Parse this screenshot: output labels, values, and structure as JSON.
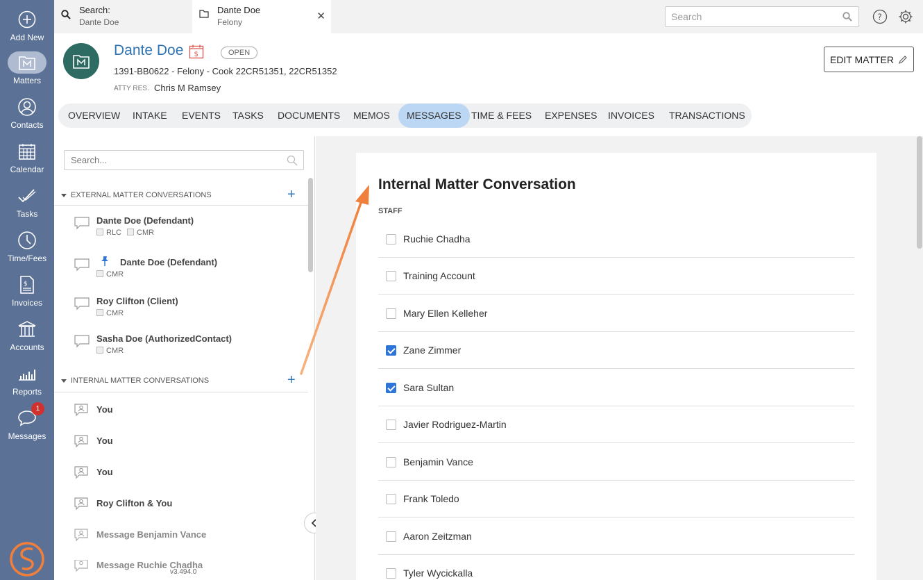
{
  "nav": {
    "items": [
      {
        "label": "Add New",
        "icon": "plus-circle-icon"
      },
      {
        "label": "Matters",
        "icon": "matter-folder-icon"
      },
      {
        "label": "Contacts",
        "icon": "contact-icon"
      },
      {
        "label": "Calendar",
        "icon": "calendar-icon"
      },
      {
        "label": "Tasks",
        "icon": "checkmark-icon"
      },
      {
        "label": "Time/Fees",
        "icon": "clock-icon"
      },
      {
        "label": "Invoices",
        "icon": "invoice-icon"
      },
      {
        "label": "Accounts",
        "icon": "bank-icon"
      },
      {
        "label": "Reports",
        "icon": "bar-chart-icon"
      },
      {
        "label": "Messages",
        "icon": "chat-bubble-icon",
        "badge": "1"
      }
    ]
  },
  "topbar": {
    "search_tab": {
      "title": "Search:",
      "subtitle": "Dante Doe"
    },
    "matter_tab": {
      "title": "Dante Doe",
      "subtitle": "Felony"
    },
    "search_placeholder": "Search"
  },
  "matter": {
    "name": "Dante Doe",
    "status": "OPEN",
    "subtitle": "1391-BB0622 - Felony - Cook 22CR51351, 22CR51352",
    "atty_label": "ATTY RES.",
    "atty": "Chris M Ramsey",
    "edit_label": "EDIT MATTER"
  },
  "tabs": [
    "OVERVIEW",
    "INTAKE",
    "EVENTS",
    "TASKS",
    "DOCUMENTS",
    "MEMOS",
    "MESSAGES",
    "TIME & FEES",
    "EXPENSES",
    "INVOICES",
    "TRANSACTIONS"
  ],
  "active_tab": "MESSAGES",
  "left_panel": {
    "search_placeholder": "Search...",
    "external_heading": "EXTERNAL MATTER CONVERSATIONS",
    "external": [
      {
        "name": "Dante Doe (Defendant)",
        "tags": [
          "RLC",
          "CMR"
        ],
        "pinned": false
      },
      {
        "name": "Dante Doe (Defendant)",
        "tags": [
          "CMR"
        ],
        "pinned": true
      },
      {
        "name": "Roy Clifton (Client)",
        "tags": [
          "CMR"
        ],
        "pinned": false
      },
      {
        "name": "Sasha Doe (AuthorizedContact)",
        "tags": [
          "CMR"
        ],
        "pinned": false
      }
    ],
    "internal_heading": "INTERNAL MATTER CONVERSATIONS",
    "internal": [
      {
        "name": "You"
      },
      {
        "name": "You"
      },
      {
        "name": "You"
      },
      {
        "name": "Roy Clifton & You"
      },
      {
        "name": "Message Benjamin Vance"
      },
      {
        "name": "Message Ruchie Chadha"
      }
    ],
    "version": "v3.494.0"
  },
  "conversation": {
    "title": "Internal Matter Conversation",
    "staff_label": "STAFF",
    "staff": [
      {
        "name": "Ruchie Chadha",
        "checked": false
      },
      {
        "name": "Training Account",
        "checked": false
      },
      {
        "name": "Mary Ellen Kelleher",
        "checked": false
      },
      {
        "name": "Zane Zimmer",
        "checked": true
      },
      {
        "name": "Sara Sultan",
        "checked": true
      },
      {
        "name": "Javier Rodriguez-Martin",
        "checked": false
      },
      {
        "name": "Benjamin Vance",
        "checked": false
      },
      {
        "name": "Frank Toledo",
        "checked": false
      },
      {
        "name": "Aaron Zeitzman",
        "checked": false
      },
      {
        "name": "Tyler Wycickalla",
        "checked": false
      }
    ]
  },
  "colors": {
    "nav_bg": "#5b7196",
    "accent": "#2f75b5",
    "active_tab": "#bcd7f3",
    "checkbox_on": "#2f75d8",
    "annotation_arrow": "#f07f3c"
  }
}
